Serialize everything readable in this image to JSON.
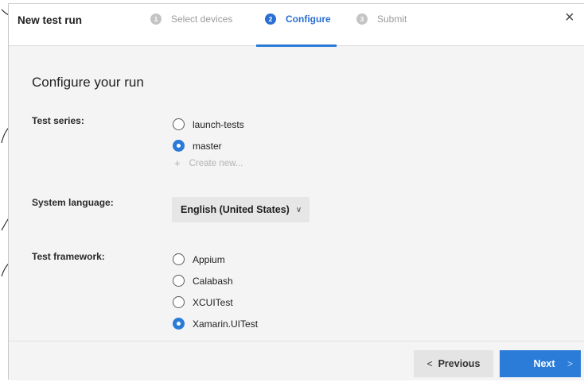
{
  "dialog": {
    "title": "New test run",
    "close_glyph": "×"
  },
  "steps": [
    {
      "number": "1",
      "label": "Select devices",
      "state": "inactive"
    },
    {
      "number": "2",
      "label": "Configure",
      "state": "active"
    },
    {
      "number": "3",
      "label": "Submit",
      "state": "inactive"
    }
  ],
  "main": {
    "heading": "Configure your run",
    "test_series": {
      "label": "Test series:",
      "options": [
        {
          "label": "launch-tests",
          "checked": false
        },
        {
          "label": "master",
          "checked": true
        }
      ],
      "create_new": "Create new...",
      "create_new_icon": "plus-icon"
    },
    "system_language": {
      "label": "System language:",
      "value": "English (United States)",
      "chevron": "∨"
    },
    "test_framework": {
      "label": "Test framework:",
      "options": [
        {
          "label": "Appium",
          "checked": false
        },
        {
          "label": "Calabash",
          "checked": false
        },
        {
          "label": "XCUITest",
          "checked": false
        },
        {
          "label": "Xamarin.UITest",
          "checked": true
        }
      ]
    }
  },
  "footer": {
    "previous_label": "Previous",
    "previous_arrow": "<",
    "next_label": "Next",
    "next_arrow": ">"
  },
  "colors": {
    "accent": "#2a7bd8",
    "panel_background": "#f4f4f5",
    "arrow_annotation": "#111111"
  }
}
